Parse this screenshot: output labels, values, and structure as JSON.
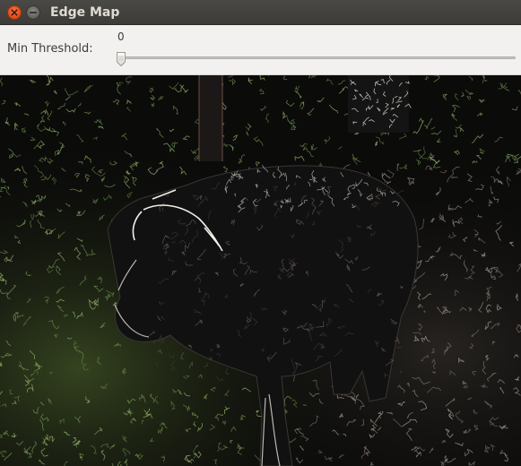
{
  "window": {
    "title": "Edge Map",
    "close_icon": "close-icon",
    "minimize_icon": "minimize-icon"
  },
  "trackbar": {
    "label": "Min Threshold:",
    "value": "0",
    "level_fraction": 0
  },
  "image": {
    "subject_colors": {
      "grass": "#7fa05a",
      "animal_edges": "#e8e4dc",
      "background": "#0b0b0a",
      "soil": "#9a8f84"
    }
  }
}
